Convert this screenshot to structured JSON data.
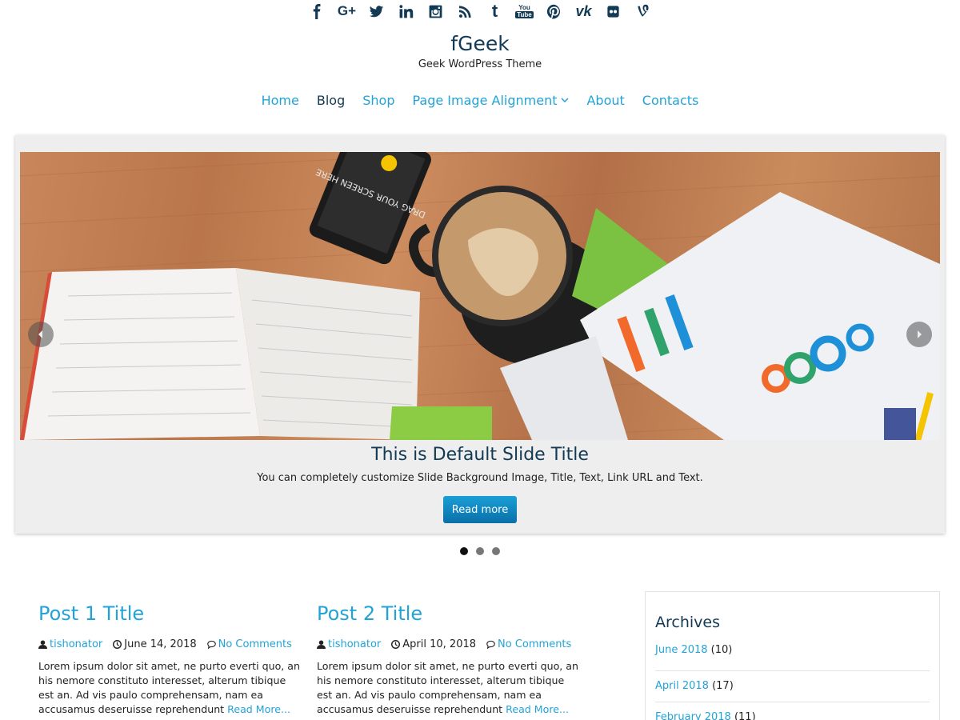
{
  "social": {
    "icons": [
      "facebook-icon",
      "google-plus-icon",
      "twitter-icon",
      "linkedin-icon",
      "instagram-icon",
      "rss-icon",
      "tumblr-icon",
      "youtube-icon",
      "pinterest-icon",
      "vk-icon",
      "flickr-icon",
      "vine-icon"
    ],
    "google_plus_text": "G+",
    "tumblr_text": "t",
    "youtube_top": "You",
    "youtube_bottom": "Tube",
    "vk_text": "vk"
  },
  "header": {
    "site_title": "fGeek",
    "tagline": "Geek WordPress Theme"
  },
  "nav": {
    "items": [
      {
        "label": "Home",
        "active": false
      },
      {
        "label": "Blog",
        "active": true
      },
      {
        "label": "Shop",
        "active": false
      },
      {
        "label": "Page Image Alignment",
        "active": false,
        "has_submenu": true
      },
      {
        "label": "About",
        "active": false
      },
      {
        "label": "Contacts",
        "active": false
      }
    ]
  },
  "slider": {
    "title": "This is Default Slide Title",
    "text": "You can completely customize Slide Background Image, Title, Text, Link URL and Text.",
    "button_label": "Read more",
    "phone_text": "DRAG YOUR SCREEN HERE",
    "dots": 3,
    "active_dot": 0
  },
  "posts": [
    {
      "title": "Post 1 Title",
      "author": "tishonator",
      "date": "June 14, 2018",
      "comments": "No Comments",
      "excerpt": "Lorem ipsum dolor sit amet, ne purto everti quo, an his nemore constituto interesset, alterum tibique est an. Ad vis paulo comprehensam, nam ea accusamus deseruisse reprehendunt",
      "read_more": "Read More..."
    },
    {
      "title": "Post 2 Title",
      "author": "tishonator",
      "date": "April 10, 2018",
      "comments": "No Comments",
      "excerpt": "Lorem ipsum dolor sit amet, ne purto everti quo, an his nemore constituto interesset, alterum tibique est an. Ad vis paulo comprehensam, nam ea accusamus deseruisse reprehendunt",
      "read_more": "Read More..."
    }
  ],
  "sidebar": {
    "title": "Archives",
    "items": [
      {
        "month": "June 2018",
        "count": "(10)"
      },
      {
        "month": "April 2018",
        "count": "(17)"
      },
      {
        "month": "February 2018",
        "count": "(11)"
      }
    ]
  },
  "colors": {
    "link": "#22a3d8",
    "heading": "#133a55",
    "button": "#0a6fa8"
  }
}
